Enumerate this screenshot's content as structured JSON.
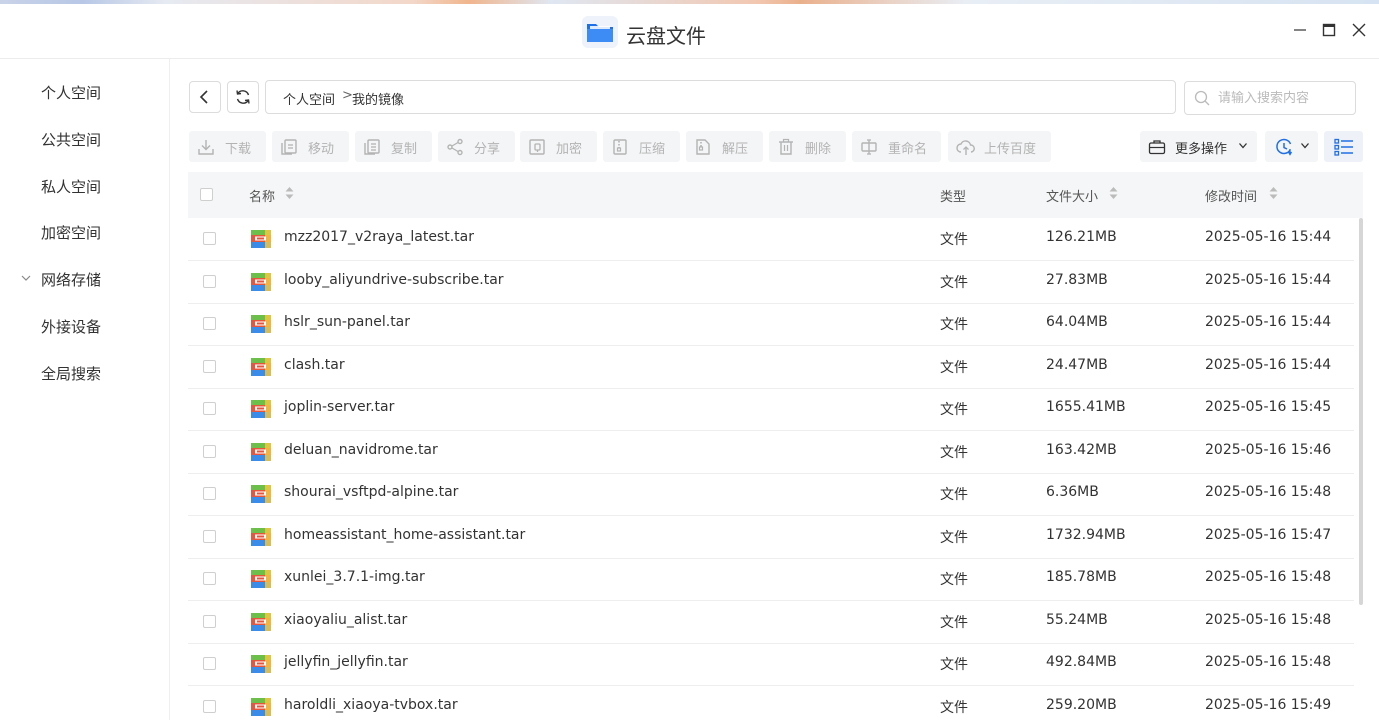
{
  "window": {
    "title": "云盘文件",
    "controls": [
      "minimize-icon",
      "maximize-icon",
      "close-icon"
    ]
  },
  "sidebar": {
    "items": [
      {
        "label": "个人空间"
      },
      {
        "label": "公共空间"
      },
      {
        "label": "私人空间"
      },
      {
        "label": "加密空间"
      },
      {
        "label": "网络存储",
        "expandable": true
      },
      {
        "label": "外接设备"
      },
      {
        "label": "全局搜索"
      }
    ]
  },
  "breadcrumb": {
    "root": "个人空间",
    "separator": ">",
    "current": "我的镜像"
  },
  "search": {
    "placeholder": "请输入搜索内容",
    "value": ""
  },
  "toolbar": {
    "buttons": [
      {
        "label": "下载",
        "icon": "download-icon"
      },
      {
        "label": "移动",
        "icon": "move-icon"
      },
      {
        "label": "复制",
        "icon": "copy-icon"
      },
      {
        "label": "分享",
        "icon": "share-icon"
      },
      {
        "label": "加密",
        "icon": "encrypt-icon"
      },
      {
        "label": "压缩",
        "icon": "compress-icon"
      },
      {
        "label": "解压",
        "icon": "extract-icon"
      },
      {
        "label": "删除",
        "icon": "trash-icon"
      },
      {
        "label": "重命名",
        "icon": "rename-icon"
      },
      {
        "label": "上传百度",
        "icon": "cloud-upload-icon"
      }
    ],
    "more_label": "更多操作",
    "sort_icon": "clock-sort-icon",
    "view_icon": "list-view-icon",
    "disabled_color": "#b3b3b3"
  },
  "table": {
    "headers": {
      "name": "名称",
      "type": "类型",
      "size": "文件大小",
      "time": "修改时间"
    },
    "rows": [
      {
        "name": "mzz2017_v2raya_latest.tar",
        "type": "文件",
        "size": "126.21MB",
        "time": "2025-05-16 15:44"
      },
      {
        "name": "looby_aliyundrive-subscribe.tar",
        "type": "文件",
        "size": "27.83MB",
        "time": "2025-05-16 15:44"
      },
      {
        "name": "hslr_sun-panel.tar",
        "type": "文件",
        "size": "64.04MB",
        "time": "2025-05-16 15:44"
      },
      {
        "name": "clash.tar",
        "type": "文件",
        "size": "24.47MB",
        "time": "2025-05-16 15:44"
      },
      {
        "name": "joplin-server.tar",
        "type": "文件",
        "size": "1655.41MB",
        "time": "2025-05-16 15:45"
      },
      {
        "name": "deluan_navidrome.tar",
        "type": "文件",
        "size": "163.42MB",
        "time": "2025-05-16 15:46"
      },
      {
        "name": "shourai_vsftpd-alpine.tar",
        "type": "文件",
        "size": "6.36MB",
        "time": "2025-05-16 15:48"
      },
      {
        "name": "homeassistant_home-assistant.tar",
        "type": "文件",
        "size": "1732.94MB",
        "time": "2025-05-16 15:47"
      },
      {
        "name": "xunlei_3.7.1-img.tar",
        "type": "文件",
        "size": "185.78MB",
        "time": "2025-05-16 15:48"
      },
      {
        "name": "xiaoyaliu_alist.tar",
        "type": "文件",
        "size": "55.24MB",
        "time": "2025-05-16 15:48"
      },
      {
        "name": "jellyfin_jellyfin.tar",
        "type": "文件",
        "size": "492.84MB",
        "time": "2025-05-16 15:48"
      },
      {
        "name": "haroldli_xiaoya-tvbox.tar",
        "type": "文件",
        "size": "259.20MB",
        "time": "2025-05-16 15:49"
      }
    ],
    "file_icon": "archive-file-icon"
  },
  "colors": {
    "accent": "#1e6fe8",
    "archive_icon_red": "#e8553d",
    "archive_icon_green": "#6cc04a",
    "archive_icon_blue": "#3b8ce8",
    "archive_icon_yellow": "#f5c63c"
  }
}
